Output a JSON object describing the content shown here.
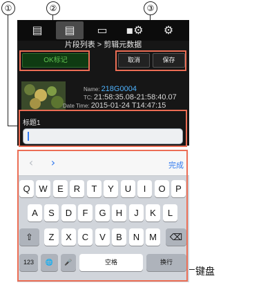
{
  "callouts": {
    "c1": "①",
    "c2": "②",
    "c3": "③"
  },
  "top_tabs": [
    {
      "icon": "▤",
      "name": "clip-list-icon"
    },
    {
      "icon": "▤",
      "name": "clip-metadata-icon"
    },
    {
      "icon": "▭",
      "name": "preview-icon"
    },
    {
      "icon": "▪⚙",
      "name": "camera-settings-icon"
    },
    {
      "icon": "⚙",
      "name": "settings-icon"
    }
  ],
  "breadcrumb": "片段列表 > 剪辑元数据",
  "buttons": {
    "ok_mark": "OK标记",
    "cancel": "取消",
    "save": "保存"
  },
  "clip": {
    "name_label": "Name:",
    "name": "218G0004",
    "tc_label": "TC:",
    "tc": "21:58:35.08-21:58:40.07",
    "datetime_label": "Date Time:",
    "datetime": "2015-01-24 T14:47:15"
  },
  "title_field": {
    "label": "标题1",
    "value": ""
  },
  "keyboard": {
    "prev": "‹",
    "next": "›",
    "done": "完成",
    "row1": [
      "Q",
      "W",
      "E",
      "R",
      "T",
      "Y",
      "U",
      "I",
      "O",
      "P"
    ],
    "row2": [
      "A",
      "S",
      "D",
      "F",
      "G",
      "H",
      "J",
      "K",
      "L"
    ],
    "row3": [
      "Z",
      "X",
      "C",
      "V",
      "B",
      "N",
      "M"
    ],
    "shift": "⇧",
    "backspace": "⌫",
    "num": "123",
    "globe": "🌐",
    "mic": "🎤",
    "space": "空格",
    "return": "换行",
    "caption": "键盘"
  },
  "colors": {
    "highlight": "#ec6d54",
    "ok_green": "#5fc24f",
    "blue_text": "#4fb3ff",
    "done_blue": "#2f78ef"
  }
}
